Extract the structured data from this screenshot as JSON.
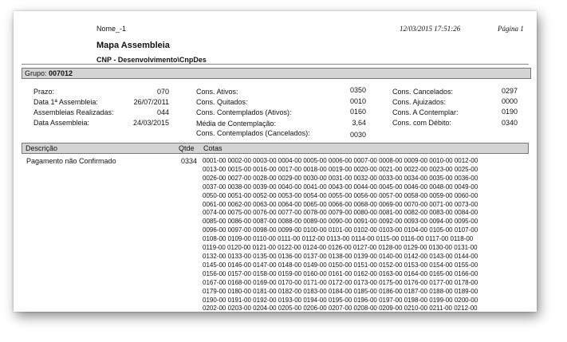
{
  "header": {
    "file_name": "Nome_-1",
    "datetime": "12/03/2015 17:51:26",
    "page": "Página 1",
    "title": "Mapa Assembleia",
    "subtitle": "CNP - Desenvolvimento\\CnpDes"
  },
  "group": {
    "label": "Grupo:",
    "value": "007012"
  },
  "left": [
    {
      "label": "Prazo:",
      "value": "070"
    },
    {
      "label": "Data 1ª Assembleia:",
      "value": "26/07/2011"
    },
    {
      "label": "Assembleias Realizadas:",
      "value": "044"
    },
    {
      "label": "Data Assembleia:",
      "value": "24/03/2015"
    }
  ],
  "middle": [
    {
      "label": "Cons. Ativos:",
      "value": "0350"
    },
    {
      "label": "Cons. Quitados:",
      "value": "0010"
    },
    {
      "label": "Cons. Contemplados (Ativos):",
      "value": "0160"
    },
    {
      "label": "Média de Contemplação:",
      "value": "3,64"
    },
    {
      "label": "Cons. Contemplados (Cancelados):",
      "value": "0030"
    }
  ],
  "right": [
    {
      "label": "Cons. Cancelados:",
      "value": "0297"
    },
    {
      "label": "Cons. Ajuizados:",
      "value": "0000"
    },
    {
      "label": "Cons. A Contemplar:",
      "value": "0190"
    },
    {
      "label": "Cons. com Débito:",
      "value": "0340"
    }
  ],
  "columns": {
    "descricao": "Descrição",
    "qtde": "Qtde",
    "cotas": "Cotas"
  },
  "row": {
    "descricao": "Pagamento não Confirmado",
    "qtde": "0334",
    "cotas_lines": [
      "0001-00 0002-00 0003-00 0004-00 0005-00 0006-00 0007-00 0008-00 0009-00 0010-00 0012-00",
      "0013-00 0015-00 0016-00 0017-00 0018-00 0019-00 0020-00 0021-00 0022-00 0023-00 0025-00",
      "0026-00 0027-00 0028-00 0029-00 0030-00 0031-00 0032-00 0033-00 0034-00 0035-00 0036-00",
      "0037-00 0038-00 0039-00 0040-00 0041-00 0043-00 0044-00 0045-00 0046-00 0048-00 0049-00",
      "0050-00 0051-00 0052-00 0053-00 0054-00 0055-00 0056-00 0057-00 0058-00 0059-00 0060-00",
      "0061-00 0062-00 0063-00 0064-00 0065-00 0066-00 0068-00 0069-00 0070-00 0071-00 0073-00",
      "0074-00 0075-00 0076-00 0077-00 0078-00 0079-00 0080-00 0081-00 0082-00 0083-00 0084-00",
      "0085-00 0086-00 0087-00 0088-00 0089-00 0090-00 0091-00 0092-00 0093-00 0094-00 0095-00",
      "0096-00 0097-00 0098-00 0099-00 0100-00 0101-00 0102-00 0103-00 0104-00 0105-00 0107-00",
      "0108-00 0109-00 0110-00 0111-00 0112-00 0113-00 0114-00 0115-00 0116-00 0117-00 0118-00",
      "0119-00 0120-00 0121-00 0122-00 0124-00 0126-00 0127-00 0128-00 0129-00 0130-00 0131-00",
      "0132-00 0133-00 0135-00 0136-00 0137-00 0138-00 0139-00 0140-00 0142-00 0143-00 0144-00",
      "0145-00 0146-00 0147-00 0148-00 0149-00 0150-00 0151-00 0152-00 0153-00 0154-00 0155-00",
      "0156-00 0157-00 0158-00 0159-00 0160-00 0161-00 0162-00 0163-00 0164-00 0165-00 0166-00",
      "0167-00 0168-00 0169-00 0170-00 0171-00 0172-00 0173-00 0175-00 0176-00 0177-00 0178-00",
      "0179-00 0180-00 0181-00 0182-00 0183-00 0184-00 0185-00 0186-00 0187-00 0188-00 0189-00",
      "0190-00 0191-00 0192-00 0193-00 0194-00 0195-00 0196-00 0197-00 0198-00 0199-00 0200-00",
      "0202-00 0203-00 0204-00 0205-00 0206-00 0207-00 0208-00 0209-00 0210-00 0211-00 0212-00"
    ]
  }
}
